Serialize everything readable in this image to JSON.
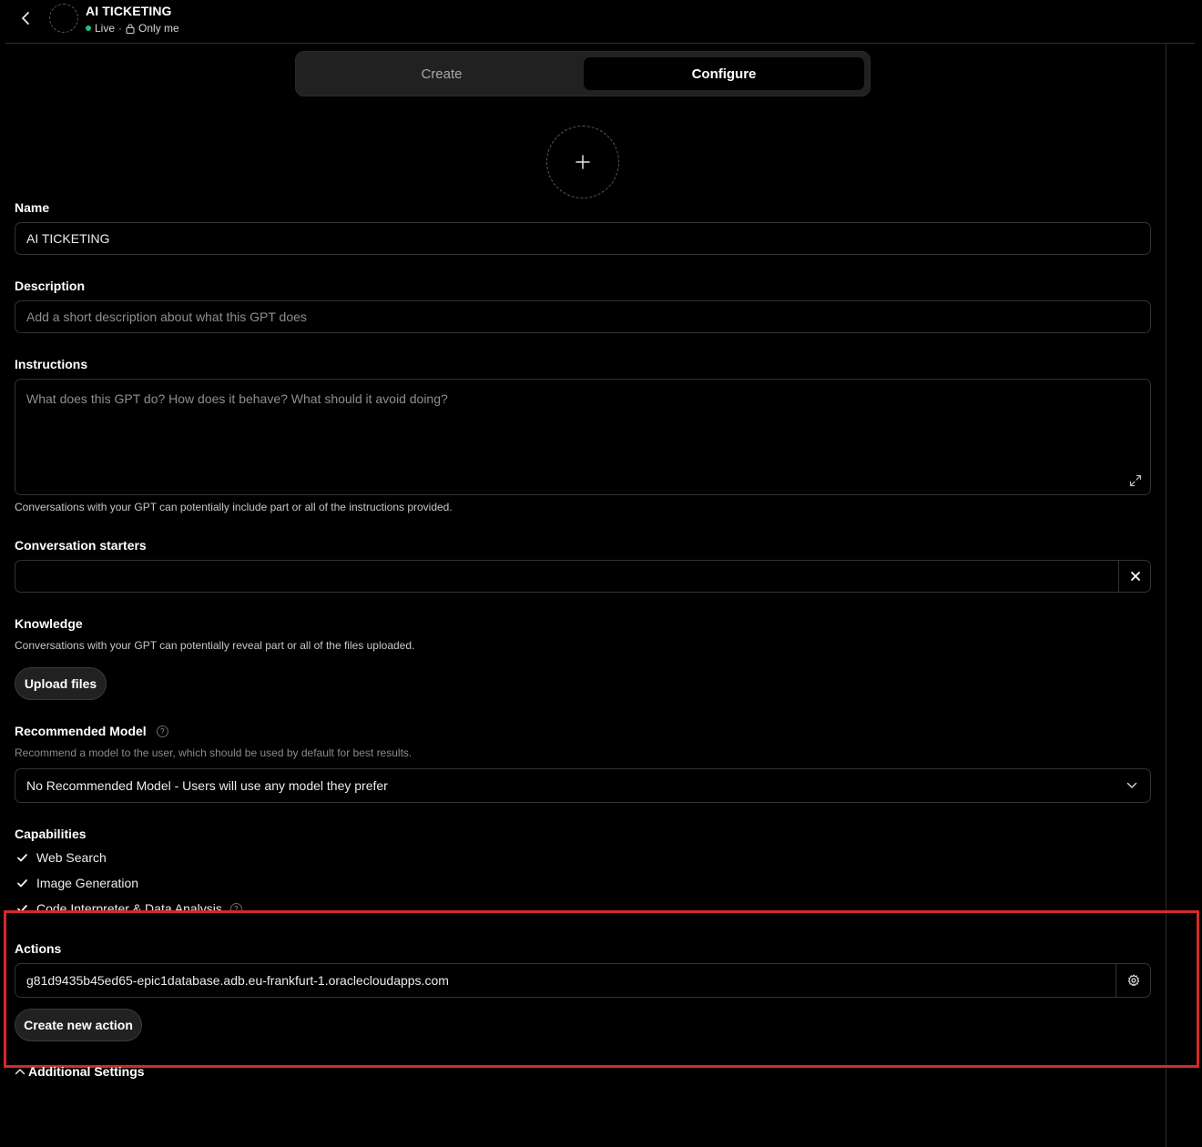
{
  "header": {
    "title": "AI TICKETING",
    "status": "Live",
    "separator": "·",
    "visibility": "Only me"
  },
  "tabs": [
    {
      "label": "Create",
      "active": false
    },
    {
      "label": "Configure",
      "active": true
    }
  ],
  "form": {
    "name": {
      "label": "Name",
      "value": "AI TICKETING"
    },
    "description": {
      "label": "Description",
      "value": "",
      "placeholder": "Add a short description about what this GPT does"
    },
    "instructions": {
      "label": "Instructions",
      "value": "",
      "placeholder": "What does this GPT do? How does it behave? What should it avoid doing?",
      "hint": "Conversations with your GPT can potentially include part or all of the instructions provided."
    },
    "conversation_starters": {
      "label": "Conversation starters",
      "value": ""
    },
    "knowledge": {
      "label": "Knowledge",
      "hint": "Conversations with your GPT can potentially reveal part or all of the files uploaded.",
      "upload_label": "Upload files"
    },
    "recommended_model": {
      "label": "Recommended Model",
      "help": "?",
      "hint": "Recommend a model to the user, which should be used by default for best results.",
      "selected": "No Recommended Model - Users will use any model they prefer"
    },
    "capabilities": {
      "label": "Capabilities",
      "items": [
        {
          "label": "Web Search",
          "checked": true
        },
        {
          "label": "Image Generation",
          "checked": true
        },
        {
          "label": "Code Interpreter & Data Analysis",
          "checked": true
        }
      ],
      "help": "?"
    },
    "actions": {
      "label": "Actions",
      "items": [
        "g81d9435b45ed65-epic1database.adb.eu-frankfurt-1.oraclecloudapps.com"
      ],
      "create_label": "Create new action"
    },
    "additional_settings": {
      "label": "Additional Settings"
    }
  },
  "colors": {
    "background": "#000000",
    "live_dot": "#19c37d",
    "highlight": "#d42a2a"
  }
}
